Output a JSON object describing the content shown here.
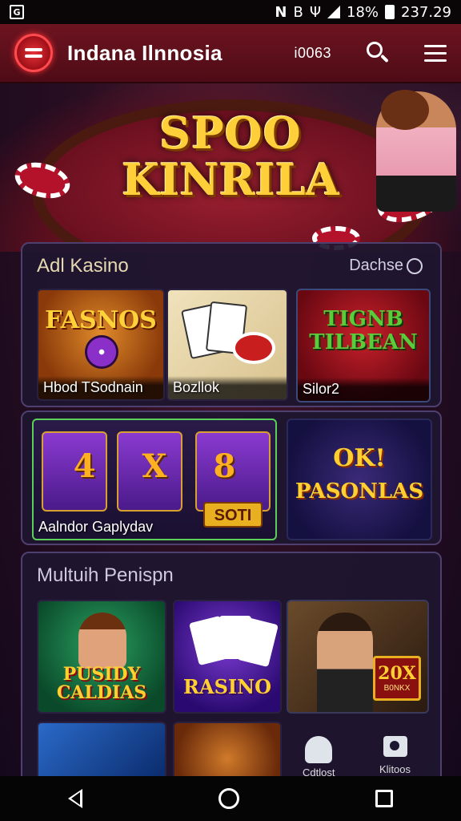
{
  "status_bar": {
    "left_badge": "G",
    "icons": [
      "N",
      "B",
      "Ψ"
    ],
    "battery_percent": "18%",
    "time": "237.29"
  },
  "header": {
    "app_title": "Indana Ilnnosia",
    "code": "i0063"
  },
  "hero": {
    "title_line1": "SPOO",
    "title_line2": "KINRILA"
  },
  "section1": {
    "title": "Adl Kasino",
    "link_label": "Dachse",
    "tiles": [
      {
        "art": "FASNOS",
        "caption": "Hbod TSodnain"
      },
      {
        "art": "",
        "caption": "Bozllok"
      },
      {
        "art": "TIGNB TILBEAN",
        "caption": "Silor2"
      }
    ]
  },
  "section2": {
    "tiles": [
      {
        "art": "4  X  8",
        "badge": "SOTI",
        "caption": "Aalndor Gaplydav"
      },
      {
        "art": "PASONLAS",
        "top_art": "OK!",
        "caption": ""
      }
    ]
  },
  "section3": {
    "title": "Multuih Penispn",
    "tiles": [
      {
        "art": "PUSIDY CALDIAS"
      },
      {
        "art": "RASINO"
      },
      {
        "art": "20X",
        "badge_sub": "B0NKX"
      }
    ],
    "bottom_icons": [
      {
        "icon": "arc-icon",
        "label": "Cdtlost"
      },
      {
        "icon": "camera-icon",
        "label": "Klitoos"
      }
    ]
  }
}
